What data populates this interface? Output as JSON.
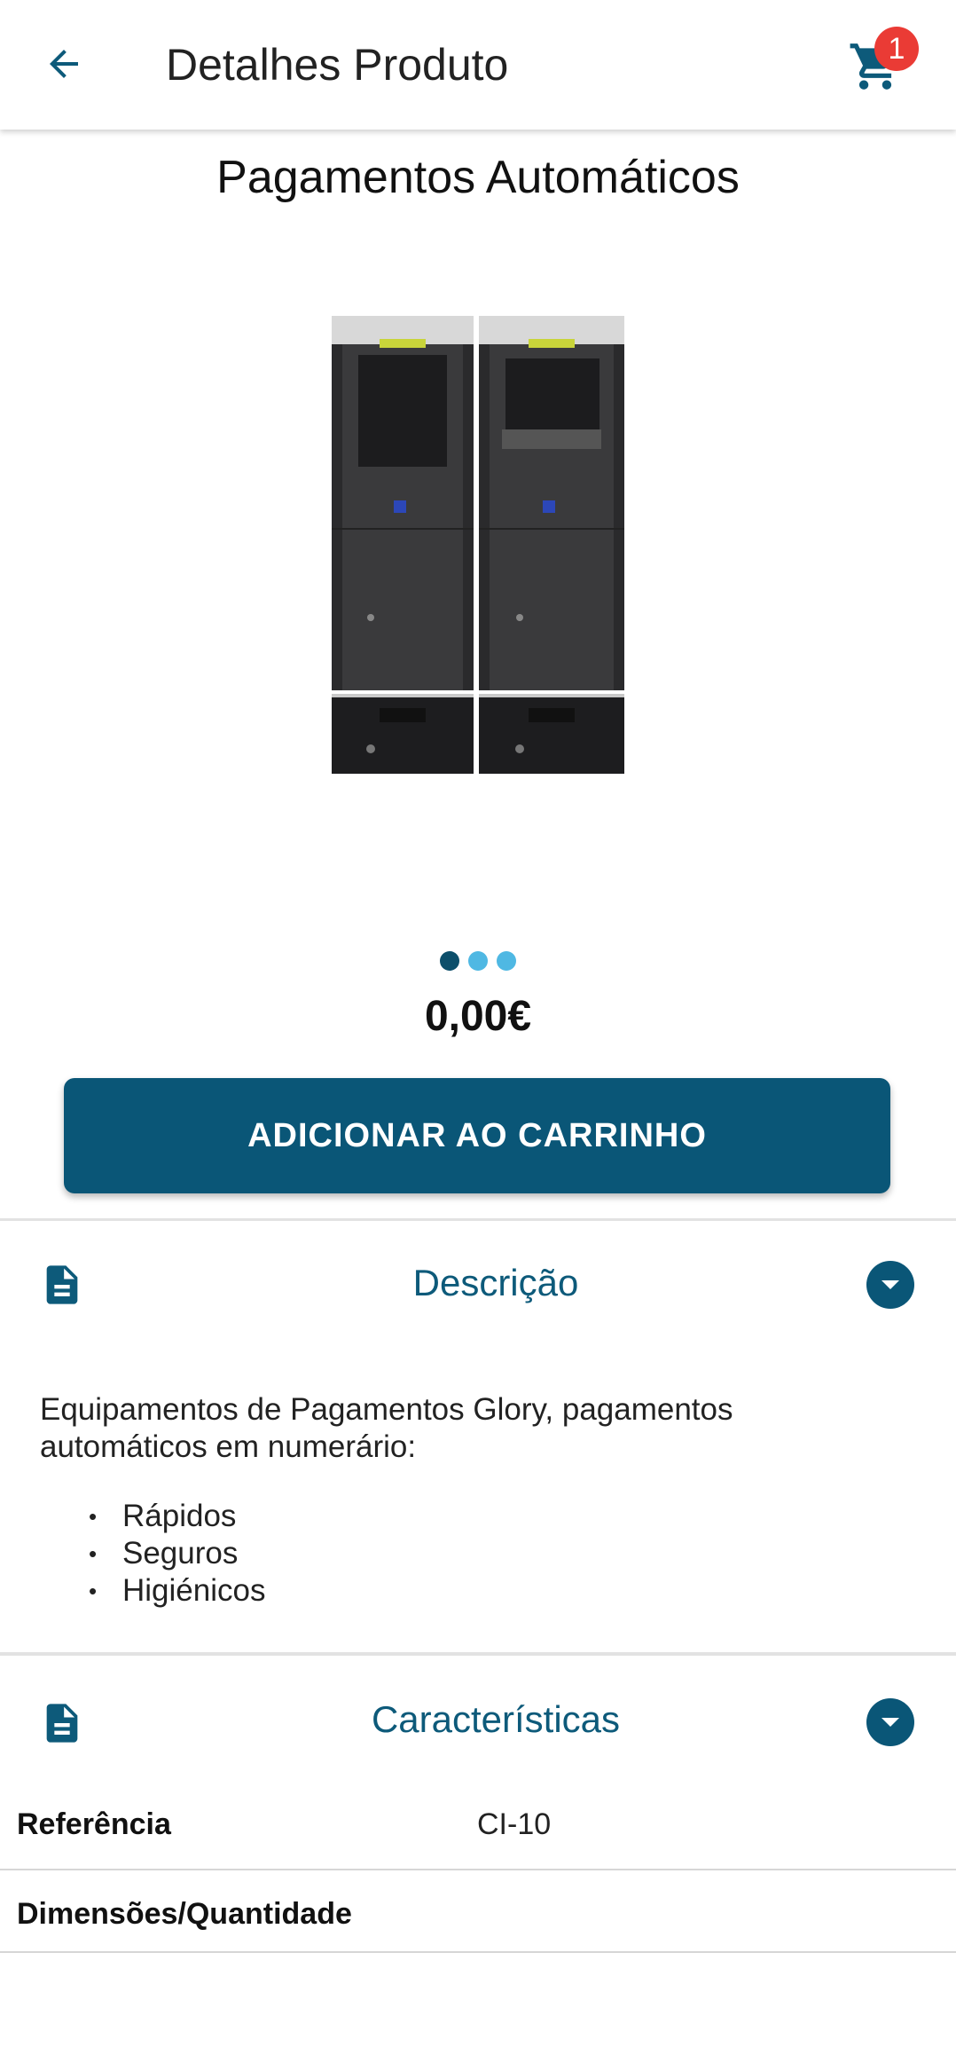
{
  "appbar": {
    "title": "Detalhes Produto",
    "back_icon": "arrow-left-icon",
    "cart_icon": "cart-icon",
    "cart_count": "1"
  },
  "product": {
    "title": "Pagamentos Automáticos",
    "image": "glory-payment-machines",
    "price": "0,00€",
    "carousel": {
      "total": 3,
      "active": 1
    }
  },
  "actions": {
    "add_to_cart": "ADICIONAR AO CARRINHO"
  },
  "description": {
    "title": "Descrição",
    "icon": "document-icon",
    "text": "Equipamentos de Pagamentos Glory, pagamentos automáticos em numerário:",
    "bullets": [
      "Rápidos",
      "Seguros",
      "Higiénicos"
    ]
  },
  "characteristics": {
    "title": "Características",
    "icon": "document-icon",
    "rows": [
      {
        "label": "Referência",
        "value": "CI-10"
      },
      {
        "label": "Dimensões/Quantidade",
        "value": ""
      }
    ]
  },
  "colors": {
    "primary": "#0a5677",
    "badge": "#ea3b35",
    "dot_inactive": "#4fb8e3"
  }
}
